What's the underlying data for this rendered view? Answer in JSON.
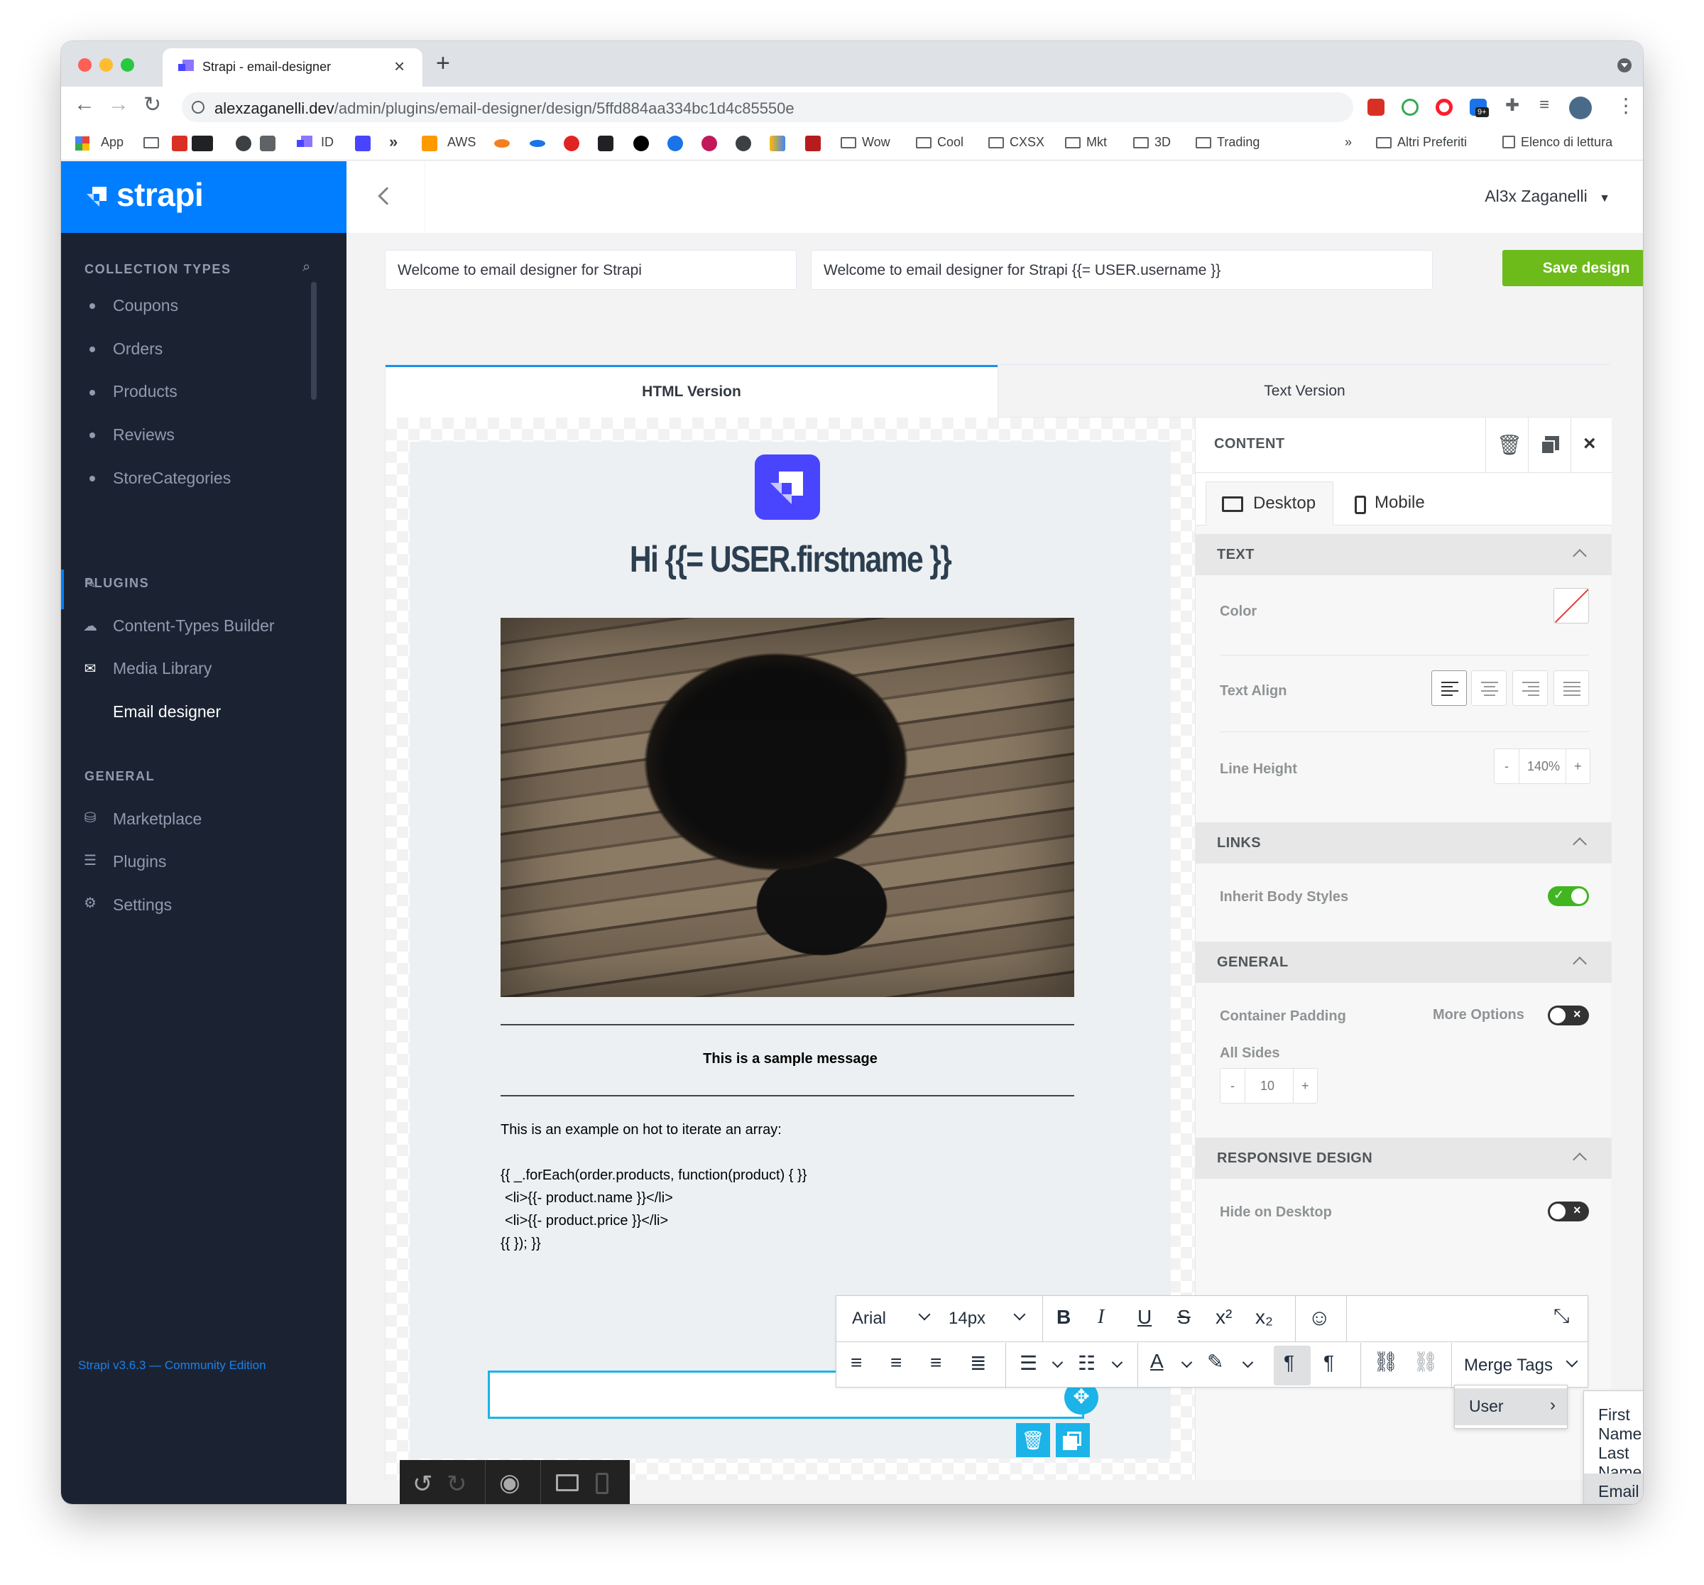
{
  "browser": {
    "tab_title": "Strapi - email-designer",
    "new_tab": "+",
    "url_host": "alexzaganelli.dev",
    "url_path": "/admin/plugins/email-designer/design/5ffd884aa334bc1d4c85550e",
    "ext_badge": "9+",
    "bookmarks": {
      "apps": "App",
      "id": "ID",
      "more_1": "»",
      "aws": "AWS",
      "wow": "Wow",
      "cool": "Cool",
      "cxsx": "CXSX",
      "mkt": "Mkt",
      "threed": "3D",
      "trading": "Trading",
      "overflow": "»",
      "others": "Altri Preferiti",
      "reading": "Elenco di lettura"
    }
  },
  "sidebar": {
    "brand": "strapi",
    "collection_types_label": "COLLECTION TYPES",
    "collection_types": [
      {
        "label": "Coupons"
      },
      {
        "label": "Orders"
      },
      {
        "label": "Products"
      },
      {
        "label": "Reviews"
      },
      {
        "label": "StoreCategories"
      }
    ],
    "plugins_label": "PLUGINS",
    "plugins": [
      {
        "label": "Content-Types Builder",
        "icon": "paintbrush-icon"
      },
      {
        "label": "Media Library",
        "icon": "cloud-upload-icon"
      },
      {
        "label": "Email designer",
        "icon": "envelope-icon",
        "active": true
      }
    ],
    "general_label": "GENERAL",
    "general": [
      {
        "label": "Marketplace",
        "icon": "basket-icon"
      },
      {
        "label": "Plugins",
        "icon": "list-icon"
      },
      {
        "label": "Settings",
        "icon": "gear-icon"
      }
    ],
    "footer": "Strapi v3.6.3 — Community Edition"
  },
  "header": {
    "user": "Al3x Zaganelli"
  },
  "form": {
    "template_name": "Welcome to email designer for Strapi",
    "subject": "Welcome to email designer for Strapi {{= USER.username }}",
    "save_label": "Save design"
  },
  "editor": {
    "tabs": [
      {
        "label": "HTML Version",
        "active": true
      },
      {
        "label": "Text Version",
        "active": false
      }
    ],
    "email": {
      "heading": "Hi {{= USER.firstname }}",
      "sample": "This is a sample message",
      "body_intro": "This is an example on hot to iterate an array:",
      "code_lines": [
        "{{ _.forEach(order.products, function(product) { }}",
        "<li>{{- product.name }}</li>",
        "<li>{{- product.price }}</li>",
        "{{ }); }}"
      ]
    },
    "rte": {
      "font": "Arial",
      "size": "14px",
      "merge_tags": "Merge Tags",
      "submenu": "User",
      "submenu_items": [
        "First Name",
        "Last Name",
        "Email"
      ],
      "highlighted": "Email"
    }
  },
  "panel": {
    "title": "CONTENT",
    "device_tabs": [
      {
        "label": "Desktop",
        "active": true
      },
      {
        "label": "Mobile",
        "active": false
      }
    ],
    "text_section": "TEXT",
    "color_label": "Color",
    "text_align_label": "Text Align",
    "line_height_label": "Line Height",
    "line_height_value": "140%",
    "links_section": "LINKS",
    "inherit_label": "Inherit Body Styles",
    "inherit_on": true,
    "general_section": "GENERAL",
    "padding_label": "Container Padding",
    "more_options_label": "More Options",
    "all_sides_label": "All Sides",
    "padding_value": "10",
    "stepper_minus": "-",
    "stepper_plus": "+",
    "responsive_section": "RESPONSIVE DESIGN",
    "hide_desktop_label": "Hide on Desktop",
    "hide_desktop_on": false
  },
  "colors": {
    "brand": "#007eff",
    "sidebar": "#1b2333",
    "save": "#6dbb1a",
    "toggle_on": "#41b620",
    "heading": "#2c3e50"
  }
}
